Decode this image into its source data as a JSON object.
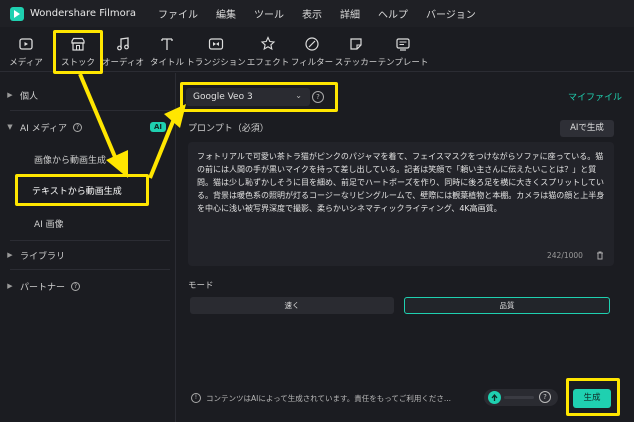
{
  "app": {
    "name": "Wondershare Filmora"
  },
  "menu": [
    "ファイル",
    "編集",
    "ツール",
    "表示",
    "詳細",
    "ヘルプ",
    "バージョン"
  ],
  "toolbar": [
    {
      "label": "メディア",
      "icon": "media-icon"
    },
    {
      "label": "ストック",
      "icon": "stock-icon"
    },
    {
      "label": "オーディオ",
      "icon": "audio-icon"
    },
    {
      "label": "タイトル",
      "icon": "title-icon"
    },
    {
      "label": "トランジション",
      "icon": "transition-icon"
    },
    {
      "label": "エフェクト",
      "icon": "effect-icon"
    },
    {
      "label": "フィルター",
      "icon": "filter-icon"
    },
    {
      "label": "ステッカー",
      "icon": "sticker-icon"
    },
    {
      "label": "テンプレート",
      "icon": "template-icon"
    }
  ],
  "sidebar": {
    "personal": "個人",
    "ai_media": "AI メディア",
    "ai_badge": "AI",
    "image_to_video": "画像から動画生成",
    "text_to_video": "テキストから動画生成",
    "ai_image": "AI 画像",
    "library": "ライブラリ",
    "partner": "パートナー"
  },
  "main": {
    "model": "Google Veo 3",
    "my_files": "マイファイル",
    "prompt_label": "プロンプト（必須）",
    "ai_generate": "AIで生成",
    "prompt_text": "フォトリアルで可愛い茶トラ猫がピンクのパジャマを着て、フェイスマスクをつけながらソファに座っている。猫の前には人間の手が黒いマイクを持って差し出している。記者は笑顔で「頼い主さんに伝えたいことは？」と質問。猫は少し恥ずかしそうに目を細め、前足でハートポーズを作り、同時に後ろ足を横に大きくスプリットしている。背景は暖色系の照明が灯るコージーなリビングルームで、壁際には観葉植物と本棚。カメラは猫の顔と上半身を中心に浅い被写界深度で撮影、柔らかいシネマティックライティング、4K高画質。",
    "char_count": "242/1000",
    "mode_label": "モード",
    "mode_fast": "速く",
    "mode_quality": "品質",
    "notice": "コンテンツはAIによって生成されています。責任をもってご利用くださ...",
    "generate": "生成"
  },
  "colors": {
    "accent": "#1fd0b0",
    "highlight": "#ffe600",
    "background": "#1b1c21"
  }
}
